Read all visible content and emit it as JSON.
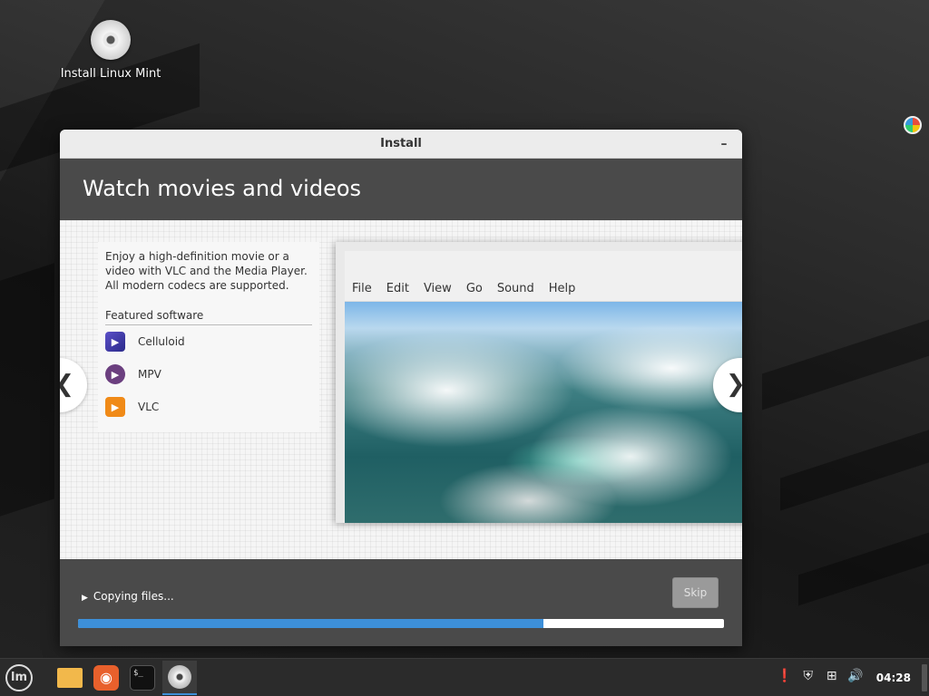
{
  "desktop": {
    "icon_label": "Install Linux Mint",
    "icon_name": "disc-icon"
  },
  "window": {
    "title": "Install",
    "minimize_glyph": "–"
  },
  "slide": {
    "heading": "Watch movies and videos",
    "description": "Enjoy a high-definition movie or a video with VLC and the Media Player. All modern codecs are supported.",
    "featured_label": "Featured software",
    "apps": [
      {
        "name": "Celluloid",
        "glyph": "▶"
      },
      {
        "name": "MPV",
        "glyph": "▶"
      },
      {
        "name": "VLC",
        "glyph": "▶"
      }
    ],
    "preview_menu": [
      "File",
      "Edit",
      "View",
      "Go",
      "Sound",
      "Help"
    ],
    "prev_glyph": "❮",
    "next_glyph": "❯"
  },
  "footer": {
    "status": "Copying files...",
    "skip_label": "Skip",
    "progress_fraction": 0.72
  },
  "taskbar": {
    "menu_glyph": "lm",
    "terminal_glyph": "$_",
    "firefox_glyph": "◉",
    "clock": "04:28",
    "tray_icons": [
      "notification-icon",
      "shield-icon",
      "network-icon",
      "volume-icon"
    ]
  },
  "colors": {
    "accent": "#3d8fd8",
    "header_band": "#4a4a4a"
  }
}
